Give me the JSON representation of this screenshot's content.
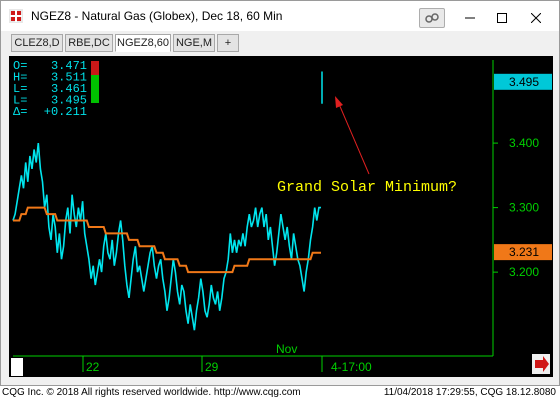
{
  "window": {
    "title": "NGEZ8 - Natural Gas (Globex), Dec 18, 60 Min"
  },
  "tabs": [
    {
      "label": "CLEZ8,D",
      "active": false
    },
    {
      "label": "RBE,DC",
      "active": false
    },
    {
      "label": "NGEZ8,60",
      "active": true
    },
    {
      "label": "NGE,M",
      "active": false
    },
    {
      "label": "+",
      "active": false
    }
  ],
  "quote_box": {
    "rows": [
      {
        "label": "O=",
        "value": "3.471"
      },
      {
        "label": "H=",
        "value": "3.511"
      },
      {
        "label": "L=",
        "value": "3.461"
      },
      {
        "label": "L=",
        "value": "3.495"
      },
      {
        "label": "Δ=",
        "value": "+0.211"
      }
    ]
  },
  "annotation": {
    "text": "Grand Solar Minimum?",
    "color": "#ffff00",
    "arrow_color": "#e02020"
  },
  "price_tags": {
    "last": "3.495",
    "last_color": "#00c8d8",
    "ma": "3.231",
    "ma_color": "#f07818"
  },
  "colors": {
    "price_line": "#00e5ee",
    "moving_average": "#f07818",
    "axis": "#00d000",
    "background": "#000000"
  },
  "chart_data": {
    "type": "line",
    "ylim": [
      3.07,
      3.535
    ],
    "y_ticks": [
      "3.400",
      "3.300",
      "3.200"
    ],
    "x_tick_labels": [
      "22",
      "29",
      "Nov",
      "4-17:00"
    ],
    "series": [
      {
        "values": [
          3.28,
          3.29,
          3.31,
          3.33,
          3.35,
          3.33,
          3.37,
          3.34,
          3.38,
          3.36,
          3.39,
          3.37,
          3.4,
          3.36,
          3.34,
          3.3,
          3.32,
          3.27,
          3.25,
          3.29,
          3.27,
          3.23,
          3.26,
          3.22,
          3.24,
          3.28,
          3.3,
          3.26,
          3.32,
          3.29,
          3.27,
          3.3,
          3.28,
          3.31,
          3.26,
          3.24,
          3.22,
          3.19,
          3.21,
          3.18,
          3.2,
          3.22,
          3.2,
          3.24,
          3.26,
          3.23,
          3.22,
          3.25,
          3.21,
          3.23,
          3.26,
          3.28,
          3.25,
          3.21,
          3.18,
          3.16,
          3.19,
          3.22,
          3.24,
          3.2,
          3.21,
          3.19,
          3.17,
          3.19,
          3.21,
          3.23,
          3.24,
          3.21,
          3.19,
          3.21,
          3.22,
          3.19,
          3.17,
          3.14,
          3.16,
          3.19,
          3.22,
          3.2,
          3.17,
          3.15,
          3.18,
          3.17,
          3.14,
          3.12,
          3.15,
          3.13,
          3.11,
          3.14,
          3.16,
          3.19,
          3.17,
          3.14,
          3.13,
          3.15,
          3.18,
          3.16,
          3.15,
          3.17,
          3.14,
          3.16,
          3.19,
          3.2,
          3.22,
          3.26,
          3.23,
          3.25,
          3.23,
          3.25,
          3.24,
          3.26,
          3.24,
          3.27,
          3.29,
          3.27,
          3.28,
          3.3,
          3.27,
          3.29,
          3.3,
          3.27,
          3.29,
          3.25,
          3.27,
          3.24,
          3.21,
          3.23,
          3.26,
          3.29,
          3.27,
          3.25,
          3.27,
          3.24,
          3.22,
          3.26,
          3.24,
          3.22,
          3.21,
          3.19,
          3.17,
          3.2,
          3.22,
          3.25,
          3.27,
          3.3,
          3.28,
          3.3,
          3.3
        ]
      },
      {
        "values": [
          3.28,
          3.28,
          3.28,
          3.28,
          3.29,
          3.29,
          3.29,
          3.3,
          3.3,
          3.3,
          3.3,
          3.3,
          3.3,
          3.3,
          3.3,
          3.3,
          3.29,
          3.29,
          3.29,
          3.29,
          3.29,
          3.28,
          3.28,
          3.28,
          3.28,
          3.28,
          3.28,
          3.28,
          3.28,
          3.28,
          3.28,
          3.28,
          3.28,
          3.28,
          3.28,
          3.28,
          3.27,
          3.27,
          3.27,
          3.27,
          3.27,
          3.27,
          3.27,
          3.27,
          3.26,
          3.26,
          3.26,
          3.26,
          3.26,
          3.26,
          3.26,
          3.26,
          3.26,
          3.26,
          3.26,
          3.25,
          3.25,
          3.25,
          3.25,
          3.25,
          3.24,
          3.24,
          3.24,
          3.24,
          3.24,
          3.24,
          3.24,
          3.24,
          3.23,
          3.23,
          3.23,
          3.23,
          3.22,
          3.22,
          3.22,
          3.22,
          3.22,
          3.22,
          3.22,
          3.21,
          3.21,
          3.21,
          3.21,
          3.2,
          3.2,
          3.2,
          3.2,
          3.2,
          3.2,
          3.2,
          3.2,
          3.2,
          3.2,
          3.2,
          3.2,
          3.2,
          3.2,
          3.2,
          3.2,
          3.2,
          3.2,
          3.2,
          3.2,
          3.2,
          3.2,
          3.21,
          3.21,
          3.21,
          3.21,
          3.21,
          3.21,
          3.21,
          3.22,
          3.22,
          3.22,
          3.22,
          3.22,
          3.22,
          3.22,
          3.22,
          3.22,
          3.22,
          3.22,
          3.22,
          3.22,
          3.22,
          3.22,
          3.22,
          3.22,
          3.22,
          3.22,
          3.22,
          3.22,
          3.22,
          3.22,
          3.22,
          3.22,
          3.22,
          3.22,
          3.22,
          3.22,
          3.22,
          3.23,
          3.23,
          3.23,
          3.23,
          3.23
        ]
      },
      {
        "values": [
          3.471,
          3.511,
          3.461,
          3.495
        ]
      }
    ]
  },
  "statusbar": {
    "left": "CQG Inc. © 2018 All rights reserved worldwide. http://www.cqg.com",
    "right": "11/04/2018 17:29:55, CQG 18.12.8080"
  }
}
